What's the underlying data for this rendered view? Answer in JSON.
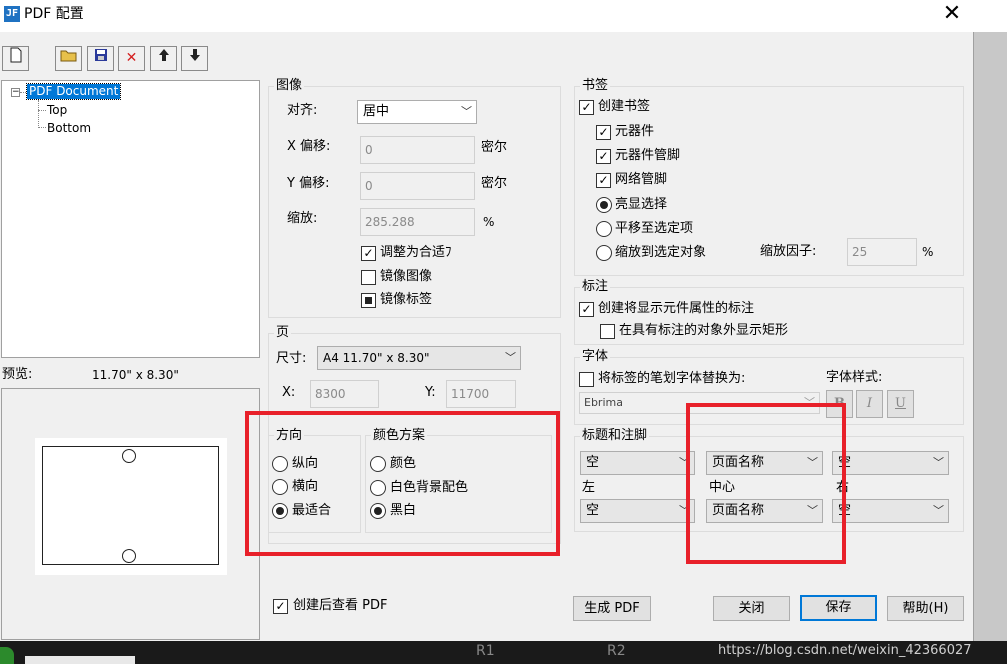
{
  "window": {
    "title": "PDF 配置",
    "icon": "pdf-app-icon",
    "close": "✕"
  },
  "toolbar": {
    "icons": [
      "new-document-icon",
      "open-folder-icon",
      "save-disk-icon",
      "delete-x-icon",
      "move-up-arrow-icon",
      "move-down-arrow-icon"
    ]
  },
  "tree": {
    "root": "PDF Document",
    "children": [
      "Top",
      "Bottom"
    ]
  },
  "preview": {
    "label": "预览:",
    "size": "11.70\" x  8.30\""
  },
  "image_group": {
    "title": "图像",
    "align_label": "对齐:",
    "align_value": "居中",
    "x_offset_label": "X 偏移:",
    "x_offset_value": "0",
    "x_unit": "密尔",
    "y_offset_label": "Y 偏移:",
    "y_offset_value": "0",
    "y_unit": "密尔",
    "scale_label": "缩放:",
    "scale_value": "285.288",
    "scale_unit": "%",
    "fit_label": "调整为合适ﾌ",
    "mirror_image_label": "镜像图像",
    "mirror_label_label": "镜像标签"
  },
  "page_group": {
    "title": "页",
    "size_label": "尺寸:",
    "size_value": "A4  11.70\" x  8.30\"",
    "x_label": "X:",
    "x_value": "8300",
    "y_label": "Y:",
    "y_value": "11700",
    "orientation_title": "方向",
    "orientation": [
      "纵向",
      "横向",
      "最适合"
    ],
    "orientation_selected": 2,
    "color_title": "颜色方案",
    "color": [
      "颜色",
      "白色背景配色",
      "黑白"
    ],
    "color_selected": 2
  },
  "view_after": "创建后查看 PDF",
  "bookmarks": {
    "title": "书签",
    "create": "创建书签",
    "components": "元器件",
    "pins": "元器件管脚",
    "net_pins": "网络管脚",
    "highlight": "亮显选择",
    "pan": "平移至选定项",
    "zoom_to": "缩放到选定对象",
    "zoom_factor_label": "缩放因子:",
    "zoom_factor_value": "25",
    "zoom_factor_unit": "%"
  },
  "annotation": {
    "title": "标注",
    "create": "创建将显示元件属性的标注",
    "rect": "在具有标注的对象外显示矩形"
  },
  "font": {
    "title": "字体",
    "replace": "将标签的笔划字体替换为:",
    "font_value": "Ebrima",
    "style_label": "字体样式:",
    "bold": "B",
    "italic": "I",
    "underline": "U"
  },
  "header_footer": {
    "title": "标题和注脚",
    "top_left": "空",
    "top_center": "页面名称",
    "top_right": "空",
    "left_label": "左",
    "center_label": "中心",
    "right_label": "右",
    "bottom_left": "空",
    "bottom_center": "页面名称",
    "bottom_right": "空"
  },
  "buttons": {
    "generate": "生成 PDF",
    "close": "关闭",
    "save": "保存",
    "help": "帮助(H)"
  },
  "taskbar": {
    "r1": "R1",
    "r2": "R2",
    "watermark": "https://blog.csdn.net/weixin_42366027"
  },
  "colors": {
    "highlight_box": "#e8202a",
    "selection": "#0078d7"
  }
}
